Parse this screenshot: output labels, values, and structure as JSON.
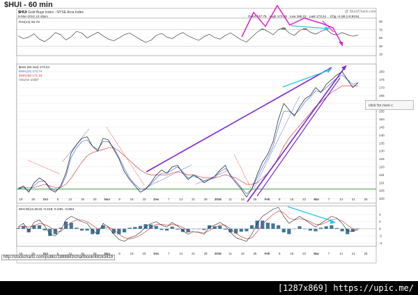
{
  "page": {
    "title": "$HUI - 60 min",
    "status_url": "http://stockcharts.com/public/1888843/chartbook/48163419",
    "next_hint": "click for next c",
    "badge": "[1287x869] https://upic.me/"
  },
  "header": {
    "symbol": "$HUI",
    "name": "Gold Bugs Index - NYSE Arca Index",
    "date": "8-Mar-2016 12:40pm",
    "watermark": "@ StockCharts.com",
    "open": "Open 167.75",
    "high": "High 173.69",
    "low": "Low 166.22",
    "last": "Last 173.24",
    "chg": "Chg +1.56 (+0.91%)"
  },
  "colors": {
    "price": "#111111",
    "ema_fast": "#2a5bd7",
    "ema_slow": "#cc2a2a",
    "trend_purple": "#7a22d6",
    "magenta": "#e21fd0",
    "cyan": "#27c6e6",
    "support_green": "#2e8b2e",
    "rsi_fill": "#3f8f3f",
    "hist": "#1f5f8b"
  },
  "chart_data": [
    {
      "type": "line",
      "title": "RSI(14) 56.78",
      "yticks": [
        10,
        30,
        50,
        70,
        90
      ],
      "ylim": [
        10,
        95
      ],
      "series": [
        {
          "name": "RSI(14)",
          "values": [
            55,
            48,
            52,
            60,
            47,
            41,
            50,
            63,
            58,
            45,
            53,
            66,
            62,
            50,
            57,
            64,
            55,
            47,
            43,
            50,
            58,
            62,
            54,
            46,
            39,
            44,
            56,
            61,
            52,
            48,
            57,
            63,
            55,
            49,
            44,
            53,
            59,
            51,
            47,
            56,
            62,
            54,
            45,
            40,
            52,
            64,
            72,
            66,
            58,
            70,
            75,
            62,
            56,
            68,
            73,
            64,
            59,
            66,
            71,
            60,
            57,
            63,
            58,
            54,
            57
          ]
        }
      ],
      "annotations": [
        "levels 30 / 70"
      ]
    },
    {
      "type": "line",
      "title": "$HUI (60 min) 173.24",
      "legend": [
        "$HUI (60 min) 173.24",
        "EMA(10) 172.74",
        "EMA(40) 171.19",
        "Volume undef"
      ],
      "ylim": [
        98,
        184
      ],
      "yticks": [
        100,
        105,
        110,
        115,
        120,
        125,
        130,
        135,
        140,
        145,
        150,
        155,
        160,
        165,
        170,
        175,
        180
      ],
      "x_tick_labels": [
        "19",
        "26",
        "Oct",
        "5",
        "12",
        "19",
        "26",
        "Nov",
        "9",
        "16",
        "23",
        "Dec",
        "7",
        "14",
        "21",
        "28",
        "2016",
        "11",
        "19",
        "25",
        "Feb",
        "8",
        "16",
        "22",
        "Mar",
        "7",
        "14",
        "21",
        "28"
      ],
      "series": [
        {
          "name": "$HUI (60 min)",
          "values": [
            106,
            108,
            104,
            110,
            113,
            111,
            106,
            104,
            108,
            116,
            129,
            134,
            138,
            139,
            133,
            130,
            138,
            137,
            131,
            125,
            117,
            112,
            108,
            104,
            106,
            110,
            115,
            118,
            116,
            120,
            121,
            116,
            112,
            115,
            113,
            110,
            112,
            114,
            118,
            121,
            114,
            110,
            106,
            101,
            106,
            115,
            123,
            128,
            136,
            150,
            160,
            156,
            152,
            158,
            163,
            165,
            170,
            167,
            172,
            175,
            178,
            180,
            175,
            170,
            173
          ]
        },
        {
          "name": "EMA(10)",
          "values": [
            106,
            107,
            105,
            108,
            111,
            111,
            107,
            105,
            107,
            114,
            126,
            132,
            136,
            137,
            133,
            131,
            136,
            136,
            132,
            126,
            119,
            113,
            109,
            106,
            106,
            109,
            113,
            116,
            116,
            118,
            120,
            117,
            113,
            114,
            113,
            111,
            112,
            113,
            117,
            119,
            115,
            111,
            107,
            103,
            106,
            113,
            120,
            126,
            133,
            145,
            155,
            155,
            153,
            156,
            161,
            164,
            168,
            167,
            170,
            173,
            176,
            178,
            175,
            172,
            173
          ]
        },
        {
          "name": "EMA(40)",
          "values": [
            107,
            107,
            107,
            107,
            108,
            109,
            108,
            107,
            107,
            109,
            113,
            118,
            123,
            127,
            129,
            130,
            131,
            132,
            132,
            130,
            127,
            124,
            121,
            118,
            116,
            115,
            115,
            115,
            115,
            116,
            117,
            116,
            115,
            115,
            114,
            113,
            113,
            113,
            114,
            115,
            114,
            113,
            111,
            109,
            109,
            110,
            113,
            116,
            120,
            126,
            133,
            138,
            142,
            146,
            150,
            154,
            158,
            161,
            164,
            167,
            169,
            171,
            171,
            171,
            171
          ]
        }
      ],
      "annotations": [
        "support 106",
        "rising channel",
        "converging resistance",
        "dashed trend lines"
      ]
    },
    {
      "type": "line",
      "title": "MACD(12,26,9) -0.218, 0.436, -0.654",
      "ylim": [
        -4.5,
        6
      ],
      "yticks": [
        -4,
        -2,
        0,
        2,
        4
      ],
      "series": [
        {
          "name": "MACD",
          "values": [
            0.5,
            1.5,
            -0.5,
            1.8,
            2.5,
            0.8,
            -1.5,
            -2,
            -0.5,
            2.5,
            3.5,
            2.8,
            2,
            1.5,
            -0.5,
            -1.5,
            1.5,
            0.5,
            -1.5,
            -3,
            -3.5,
            -2.5,
            -2,
            -1,
            0.5,
            1.5,
            2,
            1,
            0.5,
            1.8,
            0.8,
            -0.5,
            -1.5,
            -0.8,
            -1,
            -1.5,
            0.5,
            1,
            1.8,
            0.8,
            -1,
            -2.5,
            -3,
            -3.5,
            -1.5,
            1.5,
            3.5,
            4.5,
            5.5,
            6,
            3.5,
            1.5,
            2.5,
            3.5,
            2.5,
            1.5,
            0.5,
            1.5,
            2.5,
            3.5,
            3,
            1.5,
            -0.5,
            -0.8,
            -0.2
          ]
        },
        {
          "name": "Signal",
          "values": [
            0.3,
            0.8,
            0.5,
            0.8,
            1.5,
            1.2,
            0.5,
            -0.5,
            -0.8,
            0.5,
            1.8,
            2.5,
            2.5,
            2,
            1,
            0,
            0.5,
            0.5,
            -0.2,
            -1.5,
            -2.5,
            -2.8,
            -2.5,
            -1.8,
            -0.8,
            0.3,
            1.2,
            1.3,
            1,
            1.2,
            1,
            0.4,
            -0.5,
            -0.8,
            -0.9,
            -1.2,
            -0.5,
            0.3,
            1,
            1,
            0,
            -1.2,
            -2.2,
            -2.8,
            -2.5,
            -0.8,
            1.2,
            2.8,
            4,
            5,
            4.5,
            3,
            2.5,
            2.8,
            2.6,
            2,
            1.2,
            1.2,
            1.8,
            2.5,
            2.8,
            2.2,
            1,
            0,
            -0.3
          ]
        }
      ],
      "annotations": [
        "histogram",
        "bearish divergence (cyan)"
      ]
    }
  ]
}
